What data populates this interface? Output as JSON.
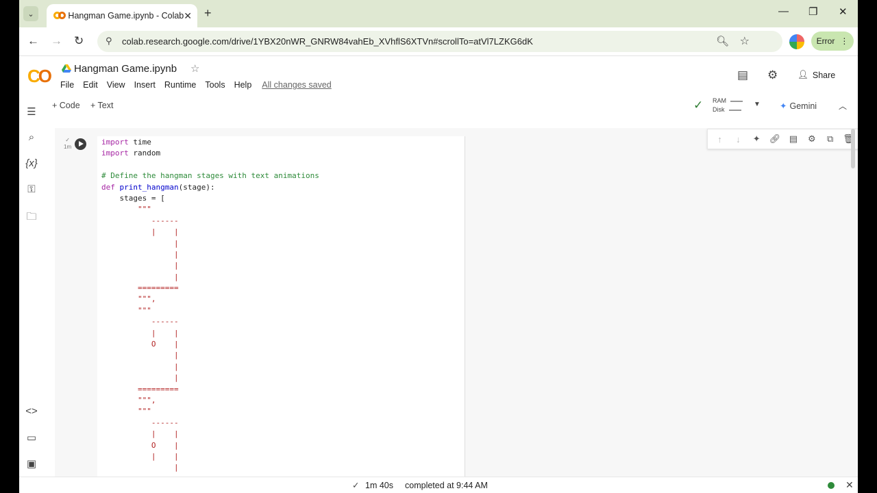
{
  "browser": {
    "tab_title": "Hangman Game.ipynb - Colab",
    "url": "colab.research.google.com/drive/1YBX20nWR_GNRW84vahEb_XVhflS6XTVn#scrollTo=atVl7LZKG6dK",
    "error_label": "Error"
  },
  "notebook": {
    "title": "Hangman Game.ipynb",
    "menu": [
      "File",
      "Edit",
      "View",
      "Insert",
      "Runtime",
      "Tools",
      "Help"
    ],
    "save_status": "All changes saved",
    "share_label": "Share"
  },
  "toolbar": {
    "add_code": "Code",
    "add_text": "Text",
    "ram_label": "RAM",
    "disk_label": "Disk",
    "gemini_label": "Gemini"
  },
  "cell": {
    "exec_time": "1m",
    "code_lines": [
      "import time",
      "import random",
      "",
      "# Define the hangman stages with text animations",
      "def print_hangman(stage):",
      "    stages = [",
      "        \"\"\"",
      "           ------",
      "           |    |",
      "                |",
      "                |",
      "                |",
      "                |",
      "        =========",
      "        \"\"\",",
      "        \"\"\"",
      "           ------",
      "           |    |",
      "           O    |",
      "                |",
      "                |",
      "                |",
      "        =========",
      "        \"\"\",",
      "        \"\"\"",
      "           ------",
      "           |    |",
      "           O    |",
      "           |    |",
      "                |"
    ]
  },
  "status": {
    "duration": "1m 40s",
    "completed": "completed at 9:44 AM"
  },
  "colors": {
    "keyword": "#a626a4",
    "comment": "#2e8b3a",
    "string": "#b22222",
    "connected": "#2e8b3a"
  }
}
